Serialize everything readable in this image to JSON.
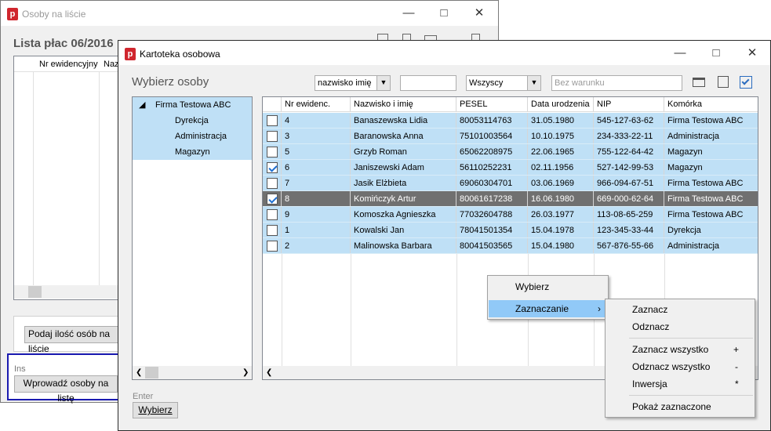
{
  "bg_window": {
    "app_icon": "p",
    "title": "Osoby na liście",
    "heading": "Lista płac 06/2016",
    "col1": "Nr ewidencyjny",
    "col2": "Naz",
    "btn_count": "Podaj ilość osób na liście",
    "shortcut": "Ins",
    "btn_enter": "Wprowadź osoby na listę"
  },
  "main_window": {
    "app_icon": "p",
    "title": "Kartoteka osobowa",
    "heading": "Wybierz osoby",
    "sort_select": "nazwisko imię",
    "search_value": "",
    "filter_select": "Wszyscy",
    "condition_placeholder": "Bez warunku",
    "footer_shortcut": "Enter",
    "footer_button": "Wybierz"
  },
  "tree": {
    "root": "Firma Testowa ABC",
    "children": [
      "Dyrekcja",
      "Administracja",
      "Magazyn"
    ]
  },
  "grid": {
    "headers": [
      "Nr ewidenc.",
      "Nazwisko i imię",
      "PESEL",
      "Data urodzenia",
      "NIP",
      "Komórka"
    ],
    "rows": [
      {
        "checked": false,
        "nr": "4",
        "name": "Banaszewska Lidia",
        "pesel": "80053114763",
        "dob": "31.05.1980",
        "nip": "545-127-63-62",
        "dept": "Firma Testowa ABC"
      },
      {
        "checked": false,
        "nr": "3",
        "name": "Baranowska Anna",
        "pesel": "75101003564",
        "dob": "10.10.1975",
        "nip": "234-333-22-11",
        "dept": "Administracja"
      },
      {
        "checked": false,
        "nr": "5",
        "name": "Grzyb Roman",
        "pesel": "65062208975",
        "dob": "22.06.1965",
        "nip": "755-122-64-42",
        "dept": "Magazyn"
      },
      {
        "checked": true,
        "nr": "6",
        "name": "Janiszewski Adam",
        "pesel": "56110252231",
        "dob": "02.11.1956",
        "nip": "527-142-99-53",
        "dept": "Magazyn"
      },
      {
        "checked": false,
        "nr": "7",
        "name": "Jasik Elżbieta",
        "pesel": "69060304701",
        "dob": "03.06.1969",
        "nip": "966-094-67-51",
        "dept": "Firma Testowa ABC"
      },
      {
        "checked": true,
        "nr": "8",
        "name": "Komińczyk Artur",
        "pesel": "80061617238",
        "dob": "16.06.1980",
        "nip": "669-000-62-64",
        "dept": "Firma Testowa ABC",
        "active": true
      },
      {
        "checked": false,
        "nr": "9",
        "name": "Komoszka Agnieszka",
        "pesel": "77032604788",
        "dob": "26.03.1977",
        "nip": "113-08-65-259",
        "dept": "Firma Testowa ABC"
      },
      {
        "checked": false,
        "nr": "1",
        "name": "Kowalski Jan",
        "pesel": "78041501354",
        "dob": "15.04.1978",
        "nip": "123-345-33-44",
        "dept": "Dyrekcja"
      },
      {
        "checked": false,
        "nr": "2",
        "name": "Malinowska Barbara",
        "pesel": "80041503565",
        "dob": "15.04.1980",
        "nip": "567-876-55-66",
        "dept": "Administracja"
      }
    ]
  },
  "context_menu": {
    "items": [
      "Wybierz",
      "Zaznaczanie"
    ]
  },
  "submenu": {
    "items": [
      {
        "label": "Zaznacz",
        "shortcut": ""
      },
      {
        "label": "Odznacz",
        "shortcut": ""
      },
      {
        "label": "Zaznacz wszystko",
        "shortcut": "+"
      },
      {
        "label": "Odznacz wszystko",
        "shortcut": "-"
      },
      {
        "label": "Inwersja",
        "shortcut": "*"
      },
      {
        "label": "Pokaż zaznaczone",
        "shortcut": ""
      }
    ]
  },
  "colors": {
    "row_selected": "#bfe0f6",
    "row_active": "#707070",
    "menu_highlight": "#91c9f7",
    "focus_frame": "#1a1ab0"
  }
}
